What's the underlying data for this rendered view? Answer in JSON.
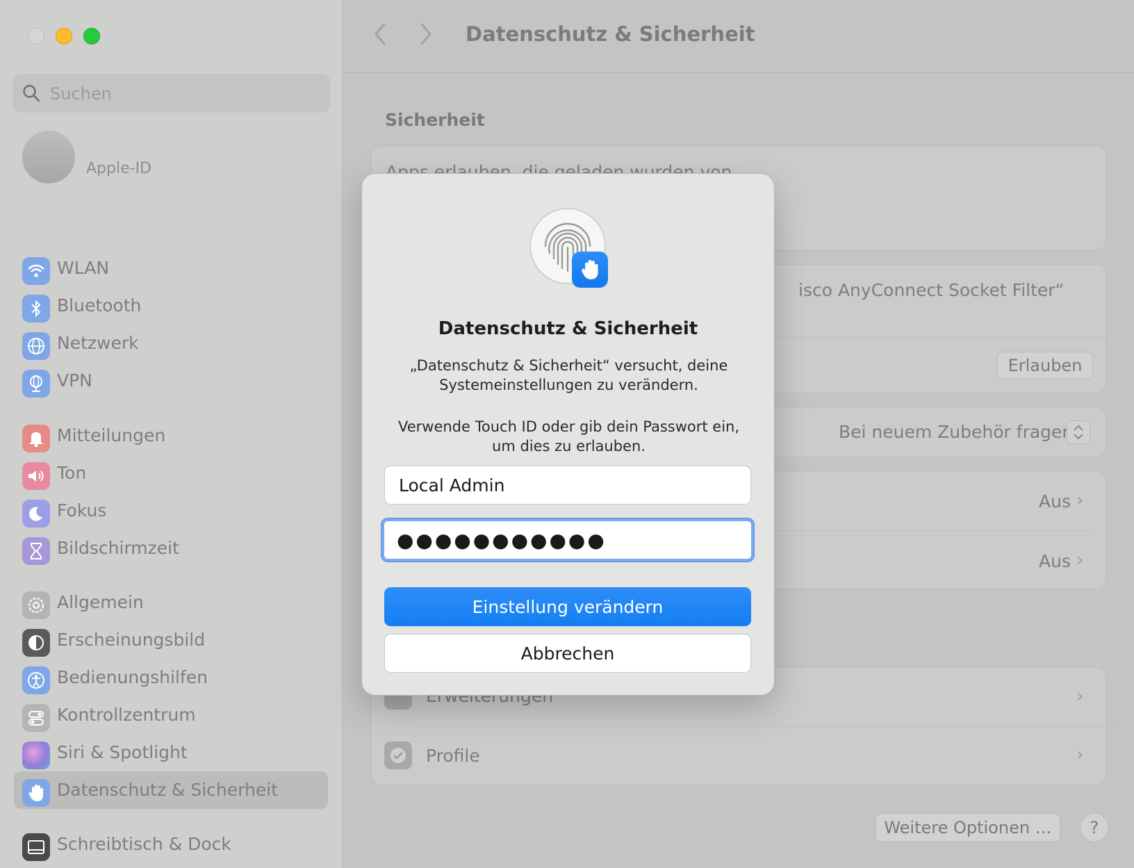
{
  "window": {
    "title": "Datenschutz & Sicherheit"
  },
  "search": {
    "placeholder": "Suchen"
  },
  "account": {
    "label": "Apple-ID"
  },
  "sidebar": {
    "items": [
      {
        "label": "WLAN",
        "icon": "wifi-icon",
        "color": "#3b82f6"
      },
      {
        "label": "Bluetooth",
        "icon": "bluetooth-icon",
        "color": "#3b82f6"
      },
      {
        "label": "Netzwerk",
        "icon": "globe-icon",
        "color": "#3b82f6"
      },
      {
        "label": "VPN",
        "icon": "vpn-globe-icon",
        "color": "#3b82f6"
      },
      {
        "label": "Mitteilungen",
        "icon": "bell-icon",
        "color": "#f04b45"
      },
      {
        "label": "Ton",
        "icon": "speaker-icon",
        "color": "#f04b70"
      },
      {
        "label": "Fokus",
        "icon": "moon-icon",
        "color": "#6366f1"
      },
      {
        "label": "Bildschirmzeit",
        "icon": "hourglass-icon",
        "color": "#7c5cd6"
      },
      {
        "label": "Allgemein",
        "icon": "gear-icon",
        "color": "#9a9a9a"
      },
      {
        "label": "Erscheinungsbild",
        "icon": "appearance-icon",
        "color": "#1f1f1f"
      },
      {
        "label": "Bedienungshilfen",
        "icon": "accessibility-icon",
        "color": "#3b82f6"
      },
      {
        "label": "Kontrollzentrum",
        "icon": "toggles-icon",
        "color": "#9a9a9a"
      },
      {
        "label": "Siri & Spotlight",
        "icon": "siri-icon",
        "color": "#a855f7"
      },
      {
        "label": "Datenschutz & Sicherheit",
        "icon": "hand-icon",
        "color": "#3b82f6",
        "selected": true
      },
      {
        "label": "Schreibtisch & Dock",
        "icon": "dock-icon",
        "color": "#2a2a2a"
      }
    ]
  },
  "main": {
    "section_title": "Sicherheit",
    "apps_allowed_label": "Apps erlauben, die geladen wurden von",
    "blocked_text": "isco AnyConnect Socket Filter“",
    "allow_button": "Erlauben",
    "accessory_value": "Bei neuem Zubehör fragen",
    "row_value_1": "Aus",
    "row_value_2": "Aus",
    "extensions_label": "Erweiterungen",
    "profiles_label": "Profile",
    "more_options": "Weitere Optionen …",
    "help": "?"
  },
  "dialog": {
    "title": "Datenschutz & Sicherheit",
    "message_line1": "„Datenschutz & Sicherheit“ versucht, deine",
    "message_line2": "Systemeinstellungen zu verändern.",
    "prompt_line1": "Verwende Touch ID oder gib dein Passwort ein,",
    "prompt_line2": "um dies zu erlauben.",
    "username": "Local Admin",
    "password_mask": "●●●●●●●●●●●",
    "confirm_button": "Einstellung verändern",
    "cancel_button": "Abbrechen",
    "accent_color": "#137ff2"
  }
}
